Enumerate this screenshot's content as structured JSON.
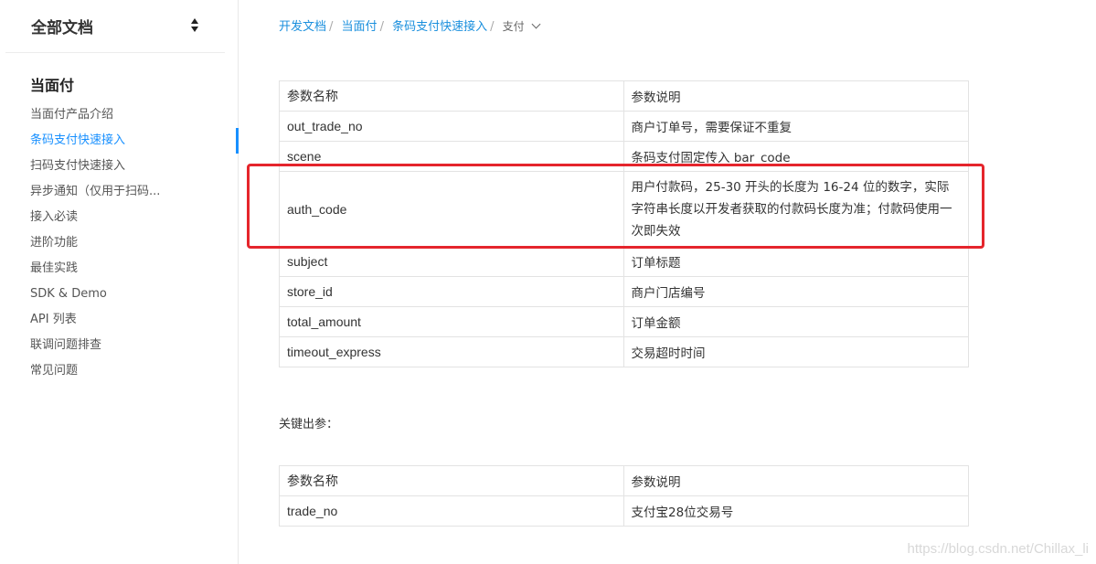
{
  "sidebar": {
    "doc_select_label": "全部文档",
    "section_title": "当面付",
    "items": [
      {
        "label": "当面付产品介绍"
      },
      {
        "label": "条码支付快速接入"
      },
      {
        "label": "扫码支付快速接入"
      },
      {
        "label": "异步通知（仅用于扫码..."
      },
      {
        "label": "接入必读"
      },
      {
        "label": "进阶功能"
      },
      {
        "label": "最佳实践"
      },
      {
        "label": "SDK & Demo"
      },
      {
        "label": "API 列表"
      },
      {
        "label": "联调问题排查"
      },
      {
        "label": "常见问题"
      }
    ],
    "active_index": 1,
    "active_color": "#1890ff"
  },
  "breadcrumb": {
    "items": [
      "开发文档",
      "当面付",
      "条码支付快速接入"
    ],
    "current": "支付"
  },
  "input_table": {
    "headers": [
      "参数名称",
      "参数说明"
    ],
    "rows": [
      {
        "name": "out_trade_no",
        "desc": "商户订单号，需要保证不重复"
      },
      {
        "name": "scene",
        "desc": "条码支付固定传入 bar_code"
      },
      {
        "name": "auth_code",
        "desc": "用户付款码，25-30 开头的长度为 16-24 位的数字，实际字符串长度以开发者获取的付款码长度为准；付款码使用一次即失效"
      },
      {
        "name": "subject",
        "desc": "订单标题"
      },
      {
        "name": "store_id",
        "desc": "商户门店编号"
      },
      {
        "name": "total_amount",
        "desc": "订单金额"
      },
      {
        "name": "timeout_express",
        "desc": "交易超时时间"
      }
    ],
    "highlight_color": "#e5252c"
  },
  "output_label": "关键出参：",
  "output_table": {
    "headers": [
      "参数名称",
      "参数说明"
    ],
    "rows": [
      {
        "name": "trade_no",
        "desc": "支付宝28位交易号"
      }
    ]
  },
  "watermark": "https://blog.csdn.net/Chillax_li"
}
